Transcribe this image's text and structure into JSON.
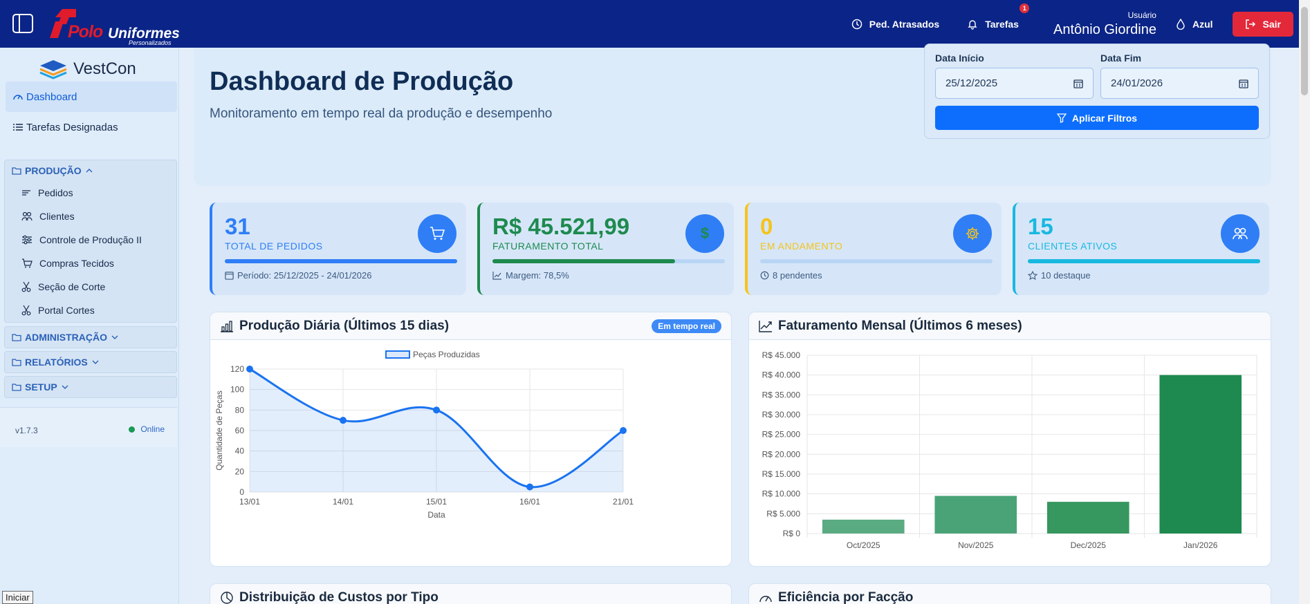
{
  "topbar": {
    "brand_polo": "Polo",
    "brand_uniformes": "Uniformes",
    "brand_tagline": "Personalizados",
    "late_orders_label": "Ped. Atrasados",
    "tasks_label": "Tarefas",
    "tasks_badge": "1",
    "user_label": "Usuário",
    "user_name": "Antônio Giordine",
    "theme_label": "Azul",
    "logout_label": "Sair"
  },
  "sidebar": {
    "app_name": "VestCon",
    "dashboard": "Dashboard",
    "tasks": "Tarefas Designadas",
    "groups": {
      "producao": "PRODUÇÃO",
      "administracao": "ADMINISTRAÇÃO",
      "relatorios": "RELATÓRIOS",
      "setup": "SETUP"
    },
    "producao_items": [
      "Pedidos",
      "Clientes",
      "Controle de Produção II",
      "Compras Tecidos",
      "Seção de Corte",
      "Portal Cortes"
    ],
    "version": "v1.7.3",
    "status": "Online"
  },
  "header": {
    "title": "Dashboard de Produção",
    "subtitle": "Monitoramento em tempo real da produção e desempenho"
  },
  "filters": {
    "start_label": "Data Início",
    "start_value": "25/12/2025",
    "end_label": "Data Fim",
    "end_value": "24/01/2026",
    "apply_label": "Aplicar Filtros"
  },
  "stats": [
    {
      "value": "31",
      "label": "TOTAL DE PEDIDOS",
      "note": "Período: 25/12/2025 - 24/01/2026",
      "color": "#2f7ef6",
      "bar": 1.0
    },
    {
      "value": "R$ 45.521,99",
      "label": "FATURAMENTO TOTAL",
      "note": "Margem: 78,5%",
      "color": "#1e8a4f",
      "bar": 0.785
    },
    {
      "value": "0",
      "label": "EM ANDAMENTO",
      "note": "8 pendentes",
      "color": "#f5c31a",
      "bar": 0.0
    },
    {
      "value": "15",
      "label": "CLIENTES ATIVOS",
      "note": "10 destaque",
      "color": "#19b8e0",
      "bar": 1.0
    }
  ],
  "panels": {
    "daily_title": "Produção Diária (Últimos 15 dias)",
    "live_badge": "Em tempo real",
    "monthly_title": "Faturamento Mensal (Últimos 6 meses)",
    "costs_title": "Distribuição de Custos por Tipo",
    "efficiency_title": "Eficiência por Facção"
  },
  "chart_data": [
    {
      "type": "line",
      "title": "Produção Diária (Últimos 15 dias)",
      "x": [
        "13/01",
        "14/01",
        "15/01",
        "16/01",
        "21/01"
      ],
      "series": [
        {
          "name": "Peças Produzidas",
          "values": [
            120,
            70,
            80,
            5,
            60
          ]
        }
      ],
      "xlabel": "Data",
      "ylabel": "Quantidade de Peças",
      "ylim": [
        0,
        120
      ],
      "yticks": [
        0,
        20,
        40,
        60,
        80,
        100,
        120
      ],
      "grid": true,
      "legend": "top-center",
      "color": "#1a73f0"
    },
    {
      "type": "bar",
      "title": "Faturamento Mensal (Últimos 6 meses)",
      "categories": [
        "Oct/2025",
        "Nov/2025",
        "Dec/2025",
        "Jan/2026"
      ],
      "values": [
        3500,
        9500,
        8000,
        40000
      ],
      "ylim": [
        0,
        45000
      ],
      "yticks": [
        0,
        5000,
        10000,
        15000,
        20000,
        25000,
        30000,
        35000,
        40000,
        45000
      ],
      "ytick_labels": [
        "R$ 0",
        "R$ 5.000",
        "R$ 10.000",
        "R$ 15.000",
        "R$ 20.000",
        "R$ 25.000",
        "R$ 30.000",
        "R$ 35.000",
        "R$ 40.000",
        "R$ 45.000"
      ],
      "bar_colors": [
        "#5aab82",
        "#4aa377",
        "#36975f",
        "#1e8a4f"
      ],
      "grid": true
    }
  ],
  "footer": {
    "start_button": "Iniciar"
  }
}
